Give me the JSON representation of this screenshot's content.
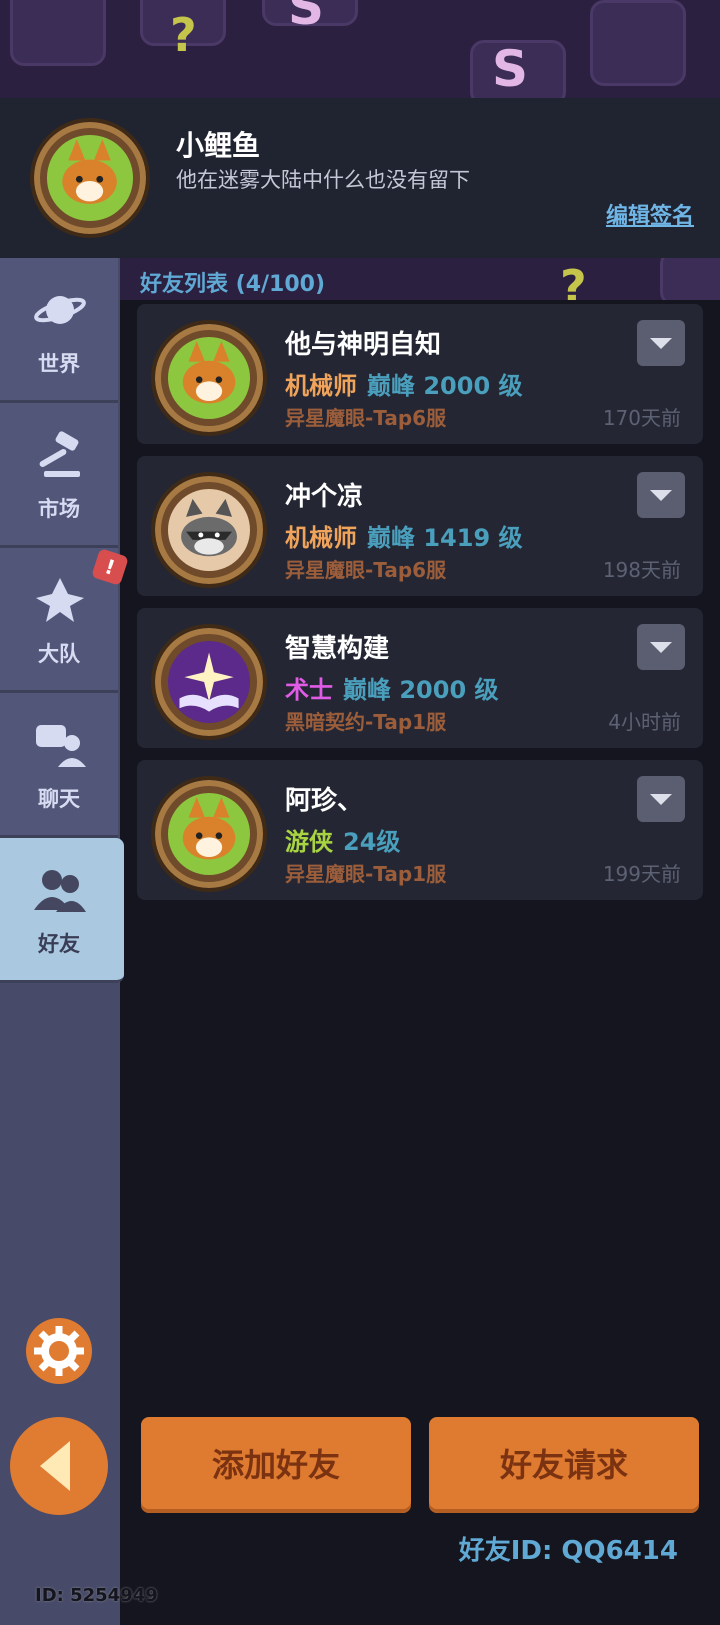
{
  "profile": {
    "name": "小鲤鱼",
    "signature": "他在迷雾大陆中什么也没有留下",
    "edit_label": "编辑签名",
    "avatar_icon": "fox-avatar-icon"
  },
  "sidebar": {
    "items": [
      {
        "label": "世界",
        "icon": "planet-icon"
      },
      {
        "label": "市场",
        "icon": "gavel-icon"
      },
      {
        "label": "大队",
        "icon": "flame-emblem-icon"
      },
      {
        "label": "聊天",
        "icon": "chat-bubbles-icon"
      },
      {
        "label": "好友",
        "icon": "friends-icon"
      }
    ],
    "badge": "!",
    "player_id": "ID: 5254949"
  },
  "friends": {
    "title": "好友列表 (4/100)",
    "items": [
      {
        "name": "他与神明自知",
        "cls": "机械师",
        "cls_color": "#f0a35a",
        "level": "巅峰 2000 级",
        "server": "异星魔眼-Tap6服",
        "time": "170天前",
        "avatar": "fox"
      },
      {
        "name": "冲个凉",
        "cls": "机械师",
        "cls_color": "#f0a35a",
        "level": "巅峰 1419 级",
        "server": "异星魔眼-Tap6服",
        "time": "198天前",
        "avatar": "raccoon"
      },
      {
        "name": "智慧构建",
        "cls": "术士",
        "cls_color": "#e05be6",
        "level": "巅峰 2000 级",
        "server": "黑暗契约-Tap1服",
        "time": "4小时前",
        "avatar": "book"
      },
      {
        "name": "阿珍、",
        "cls": "游侠",
        "cls_color": "#a8d442",
        "level": "24级",
        "server": "异星魔眼-Tap1服",
        "time": "199天前",
        "avatar": "fox"
      }
    ]
  },
  "buttons": {
    "add": "添加好友",
    "requests": "好友请求"
  },
  "friend_id": "好友ID: QQ6414",
  "colors": {
    "accent": "#df7a31",
    "link": "#5fa9d4"
  }
}
